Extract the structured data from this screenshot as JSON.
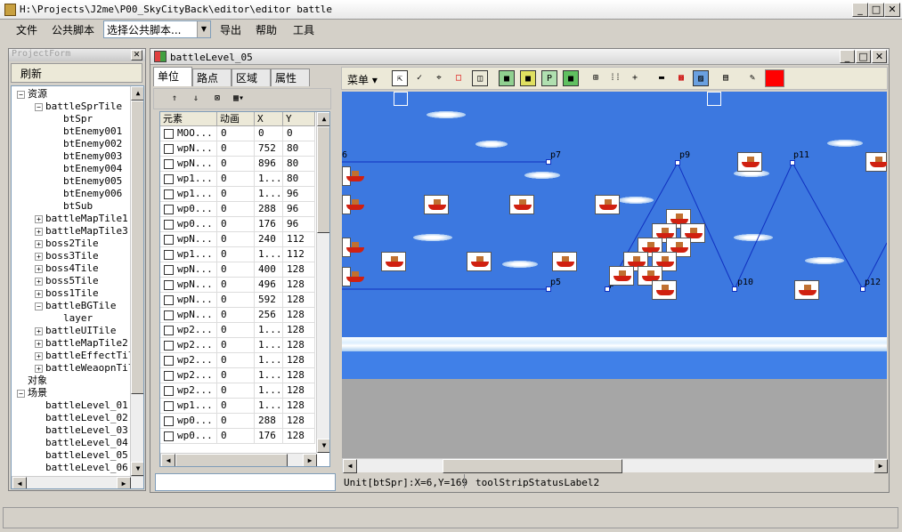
{
  "window": {
    "title": "H:\\Projects\\J2me\\P00_SkyCityBack\\editor\\editor battle"
  },
  "menu": {
    "file": "文件",
    "common_script": "公共脚本",
    "combo_value": "选择公共脚本...",
    "export": "导出",
    "help": "帮助",
    "tools": "工具"
  },
  "project": {
    "title": "ProjectForm",
    "refresh": "刷新",
    "tree": [
      {
        "label": "资源",
        "expander": "−"
      },
      {
        "label": "battleSprTile",
        "expander": "−"
      },
      {
        "label": "btSpr"
      },
      {
        "label": "btEnemy001"
      },
      {
        "label": "btEnemy002"
      },
      {
        "label": "btEnemy003"
      },
      {
        "label": "btEnemy004"
      },
      {
        "label": "btEnemy005"
      },
      {
        "label": "btEnemy006"
      },
      {
        "label": "btSub"
      },
      {
        "label": "battleMapTile1",
        "expander": "+"
      },
      {
        "label": "battleMapTile3",
        "expander": "+"
      },
      {
        "label": "boss2Tile",
        "expander": "+"
      },
      {
        "label": "boss3Tile",
        "expander": "+"
      },
      {
        "label": "boss4Tile",
        "expander": "+"
      },
      {
        "label": "boss5Tile",
        "expander": "+"
      },
      {
        "label": "boss1Tile",
        "expander": "+"
      },
      {
        "label": "battleBGTile",
        "expander": "−"
      },
      {
        "label": "layer"
      },
      {
        "label": "battleUITile",
        "expander": "+"
      },
      {
        "label": "battleMapTile2",
        "expander": "+"
      },
      {
        "label": "battleEffectTil",
        "expander": "+"
      },
      {
        "label": "battleWeaopnTil",
        "expander": "+"
      },
      {
        "label": "对象"
      },
      {
        "label": "场景",
        "expander": "−"
      },
      {
        "label": "battleLevel_01"
      },
      {
        "label": "battleLevel_02"
      },
      {
        "label": "battleLevel_03"
      },
      {
        "label": "battleLevel_04"
      },
      {
        "label": "battleLevel_05"
      },
      {
        "label": "battleLevel_06"
      }
    ]
  },
  "level": {
    "title": "battleLevel_05",
    "tabs": [
      "单位",
      "路点",
      "区域",
      "属性"
    ],
    "menu_label": "菜单",
    "columns": [
      "元素",
      "动画",
      "X",
      "Y"
    ],
    "rows": [
      [
        "MOO...",
        "0",
        "0",
        "0"
      ],
      [
        "wpN...",
        "0",
        "752",
        "80"
      ],
      [
        "wpN...",
        "0",
        "896",
        "80"
      ],
      [
        "wp1...",
        "0",
        "1...",
        "80"
      ],
      [
        "wp1...",
        "0",
        "1...",
        "96"
      ],
      [
        "wp0...",
        "0",
        "288",
        "96"
      ],
      [
        "wp0...",
        "0",
        "176",
        "96"
      ],
      [
        "wpN...",
        "0",
        "240",
        "112"
      ],
      [
        "wp1...",
        "0",
        "1...",
        "112"
      ],
      [
        "wpN...",
        "0",
        "400",
        "128"
      ],
      [
        "wpN...",
        "0",
        "496",
        "128"
      ],
      [
        "wpN...",
        "0",
        "592",
        "128"
      ],
      [
        "wpN...",
        "0",
        "256",
        "128"
      ],
      [
        "wp2...",
        "0",
        "1...",
        "128"
      ],
      [
        "wp2...",
        "0",
        "1...",
        "128"
      ],
      [
        "wp2...",
        "0",
        "1...",
        "128"
      ],
      [
        "wp2...",
        "0",
        "1...",
        "128"
      ],
      [
        "wp2...",
        "0",
        "1...",
        "128"
      ],
      [
        "wp1...",
        "0",
        "1...",
        "128"
      ],
      [
        "wp0...",
        "0",
        "288",
        "128"
      ],
      [
        "wp0...",
        "0",
        "176",
        "128"
      ]
    ],
    "points": [
      "6",
      "p7",
      "p9",
      "p11",
      "p5",
      "p",
      "p10",
      "p12"
    ],
    "status": "Unit[btSpr]:X=6,Y=169",
    "status2": "toolStripStatusLabel2",
    "colors": {
      "sky": "#3c78e0",
      "ground": "#a6a6a6",
      "path": "#1030c0",
      "swatch": "#ff0000"
    }
  }
}
